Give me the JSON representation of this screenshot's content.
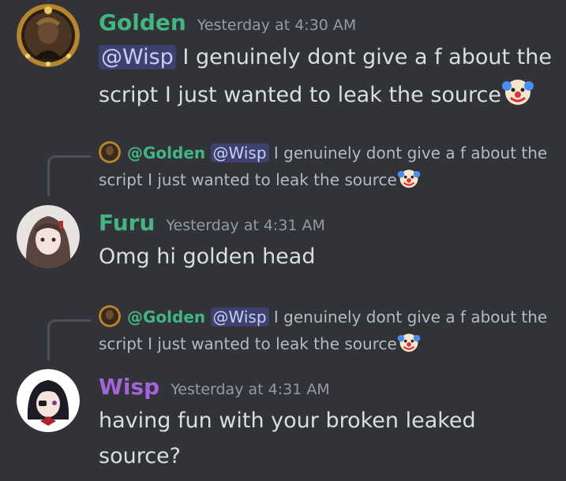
{
  "colors": {
    "background": "#313338",
    "golden": "#43b581",
    "furu": "#43b581",
    "wisp": "#a463d6",
    "timestamp": "#949ba4",
    "mention_bg": "#3c4270",
    "mention_text": "#c9cdfb"
  },
  "messages": [
    {
      "author": "Golden",
      "timestamp": "Yesterday at 4:30 AM",
      "mention": "@Wisp",
      "text": " I genuinely dont give a f about the script I just wanted to leak the source",
      "emoji": "clown-face",
      "avatar": "golden-avatar"
    },
    {
      "reply": {
        "author": "@Golden",
        "mention": "@Wisp",
        "text": " I genuinely dont give a f about the script I just wanted to leak the source",
        "emoji": "clown-face"
      },
      "author": "Furu",
      "timestamp": "Yesterday at 4:31 AM",
      "text": "Omg hi golden head",
      "avatar": "furu-avatar"
    },
    {
      "reply": {
        "author": "@Golden",
        "mention": "@Wisp",
        "text": " I genuinely dont give a f about the script I just wanted to leak the source",
        "emoji": "clown-face"
      },
      "author": "Wisp",
      "timestamp": "Yesterday at 4:31 AM",
      "text": "having fun with your broken leaked source?",
      "avatar": "wisp-avatar"
    }
  ]
}
